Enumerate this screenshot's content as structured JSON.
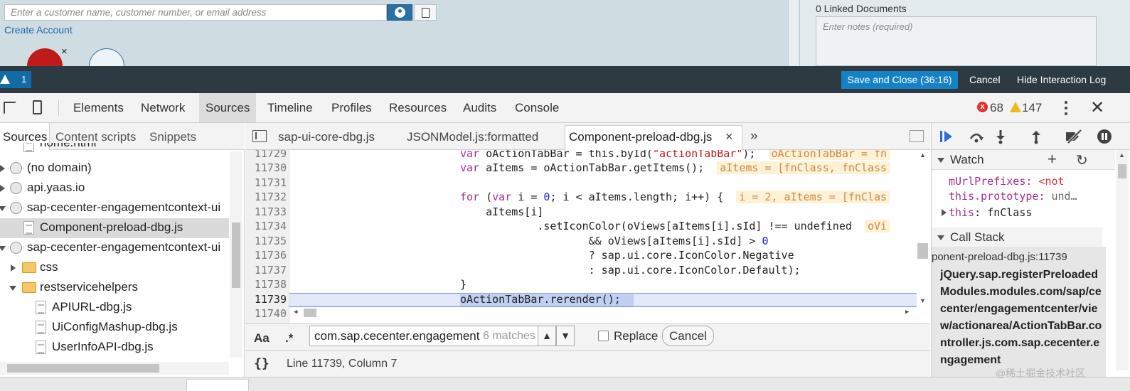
{
  "app": {
    "customer_search_placeholder": "Enter a customer name, customer number, or email address",
    "create_account": "Create Account",
    "avatar_close": "×",
    "linked_documents": "0 Linked Documents",
    "notes_placeholder": "Enter notes (required)"
  },
  "actionbar": {
    "warning_count": "1",
    "save_close": "Save and Close (36:16)",
    "cancel": "Cancel",
    "hide_log": "Hide Interaction Log"
  },
  "devtools": {
    "tabs": [
      "Elements",
      "Network",
      "Sources",
      "Timeline",
      "Profiles",
      "Resources",
      "Audits",
      "Console"
    ],
    "active_tab": "Sources",
    "error_count": "68",
    "warning_count": "147",
    "close": "✕"
  },
  "navigator": {
    "tabs": [
      "Sources",
      "Content scripts",
      "Snippets"
    ],
    "tree": [
      {
        "label": "home.html",
        "type": "file",
        "depth": 2
      },
      {
        "label": "(no domain)",
        "type": "domain",
        "depth": 0,
        "expanded": false
      },
      {
        "label": "api.yaas.io",
        "type": "domain",
        "depth": 0,
        "expanded": false
      },
      {
        "label": "sap-cecenter-engagementcontext-ui",
        "type": "domain",
        "depth": 0,
        "expanded": true
      },
      {
        "label": "Component-preload-dbg.js",
        "type": "file",
        "depth": 1,
        "selected": true
      },
      {
        "label": "sap-cecenter-engagementcontext-ui",
        "type": "domain",
        "depth": 0,
        "expanded": true
      },
      {
        "label": "css",
        "type": "folder",
        "depth": 1,
        "expanded": false
      },
      {
        "label": "restservicehelpers",
        "type": "folder",
        "depth": 1,
        "expanded": true
      },
      {
        "label": "APIURL-dbg.js",
        "type": "file",
        "depth": 2
      },
      {
        "label": "UiConfigMashup-dbg.js",
        "type": "file",
        "depth": 2
      },
      {
        "label": "UserInfoAPI-dbg.js",
        "type": "file",
        "depth": 2
      }
    ]
  },
  "editor": {
    "tabs": [
      "sap-ui-core-dbg.js",
      "JSONModel.js:formatted",
      "Component-preload-dbg.js"
    ],
    "active_tab": "Component-preload-dbg.js",
    "more_tabs": "»",
    "tab_close": "×",
    "lines": [
      {
        "n": "11729",
        "code": "var oActionTabBar = this.byId(\"actionTabBar\");",
        "inline": "oActionTabBar = fn"
      },
      {
        "n": "11730",
        "code": "var aItems = oActionTabBar.getItems();",
        "inline": "aItems = [fnClass, fnClass"
      },
      {
        "n": "11731",
        "code": "",
        "inline": ""
      },
      {
        "n": "11732",
        "code": "for (var i = 0; i < aItems.length; i++) {",
        "inline": "i = 2, aItems = [fnClas"
      },
      {
        "n": "11733",
        "code": "    aItems[i]",
        "inline": ""
      },
      {
        "n": "11734",
        "code": "            .setIconColor(oViews[aItems[i].sId] !== undefined",
        "inline": "oVi"
      },
      {
        "n": "11735",
        "code": "                    && oViews[aItems[i].sId] > 0",
        "inline": ""
      },
      {
        "n": "11736",
        "code": "                    ? sap.ui.core.IconColor.Negative",
        "inline": ""
      },
      {
        "n": "11737",
        "code": "                    : sap.ui.core.IconColor.Default);",
        "inline": ""
      },
      {
        "n": "11738",
        "code": "}",
        "inline": ""
      },
      {
        "n": "11739",
        "code": "oActionTabBar.rerender();",
        "inline": ""
      },
      {
        "n": "11740",
        "code": "",
        "inline": ""
      }
    ],
    "search": {
      "case_label": "Aa",
      "regex_label": ".*",
      "value": "com.sap.cecenter.engagement",
      "match_count": "6 matches",
      "prev": "▲",
      "next": "▼",
      "replace_label": "Replace",
      "cancel": "Cancel"
    },
    "status": {
      "pretty_print": "{}",
      "cursor": "Line 11739, Column 7"
    }
  },
  "sidebar": {
    "watch_title": "Watch",
    "add": "+",
    "refresh": "↻",
    "watch_items": [
      {
        "name": "mUrlPrefixes",
        "value": "<not",
        "error": true
      },
      {
        "name": "this.prototype",
        "value": "und…",
        "error": false
      },
      {
        "name": "this",
        "value": "fnClass",
        "error": false,
        "expandable": true
      }
    ],
    "callstack_title": "Call Stack",
    "callstack_location": "ponent-preload-dbg.js:11739",
    "callstack_function": "jQuery.sap.registerPreloadedModules.modules.com/sap/cecenter/engagementcenter/view/actionarea/ActionTabBar.controller.js.com.sap.cecenter.engagement"
  },
  "watermark": "@稀土掘金技术社区"
}
